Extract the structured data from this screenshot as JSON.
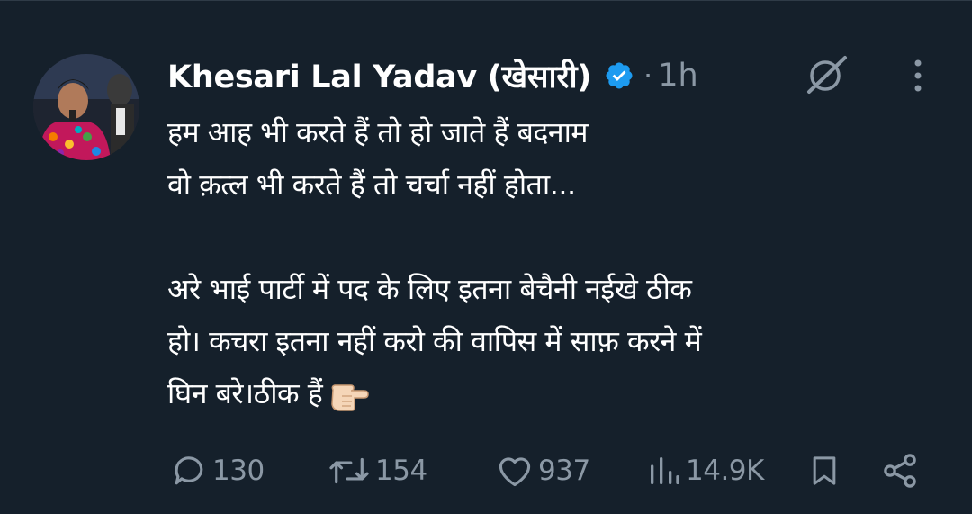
{
  "author": {
    "name": "Khesari Lal Yadav (खेसारी)",
    "timestamp_separator": "·",
    "timestamp": "1h"
  },
  "tweet": {
    "lines": [
      "हम आह भी करते हैं तो हो जाते हैं बदनाम",
      "वो क़त्ल भी करते हैं तो चर्चा नहीं होता...",
      "अरे भाई पार्टी में पद के लिए इतना बेचैनी नईखे ठीक",
      "हो। कचरा इतना नहीं करो की वापिस में साफ़ करने में",
      "घिन बरे।ठीक हैं"
    ]
  },
  "actions": {
    "replies": "130",
    "reposts": "154",
    "likes": "937",
    "views": "14.9K"
  },
  "colors": {
    "background": "#15202b",
    "text": "#ffffff",
    "muted": "#8b98a5",
    "verified": "#1d9bf0"
  }
}
